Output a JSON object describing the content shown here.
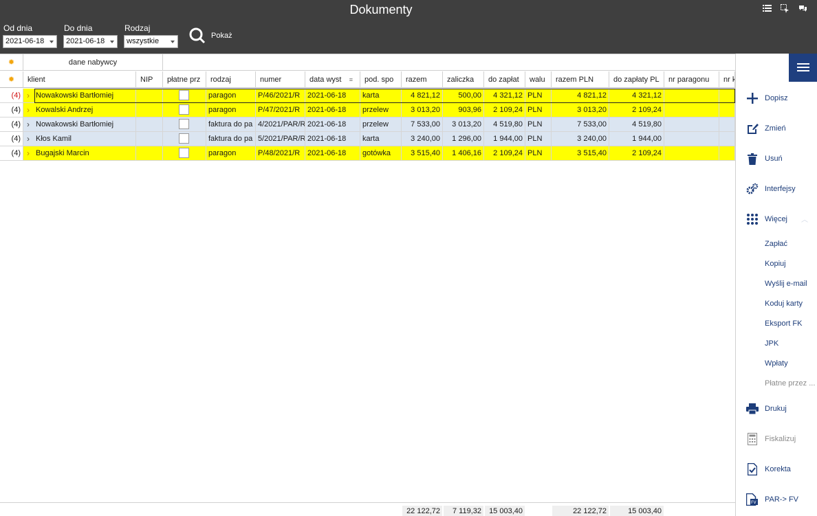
{
  "window": {
    "title": "Dokumenty"
  },
  "filters": {
    "from_label": "Od dnia",
    "from_value": "2021-06-18",
    "to_label": "Do dnia",
    "to_value": "2021-06-18",
    "type_label": "Rodzaj",
    "type_value": "wszystkie",
    "show_label": "Pokaż"
  },
  "grid": {
    "group_header": "dane nabywcy",
    "columns": [
      "klient",
      "NIP",
      "płatne prz",
      "rodzaj",
      "numer",
      "data wyst",
      "pod. spo",
      "razem",
      "zaliczka",
      "do zapłat",
      "walu",
      "razem PLN",
      "do zapłaty PL",
      "nr paragonu",
      "nr k"
    ],
    "rows": [
      {
        "count": "(4)",
        "klient": "Nowakowski Bartłomiej",
        "nip": "",
        "rodzaj": "paragon",
        "numer": "P/46/2021/R",
        "data": "2021-06-18",
        "pod": "karta",
        "razem": "4 821,12",
        "zaliczka": "500,00",
        "do_zaplaty": "4 321,12",
        "waluta": "PLN",
        "razem_pln": "4 821,12",
        "do_zaplaty_pln": "4 321,12",
        "bg": "#ffff00",
        "count_color": "#d01010"
      },
      {
        "count": "(4)",
        "klient": "Kowalski Andrzej",
        "nip": "",
        "rodzaj": "paragon",
        "numer": "P/47/2021/R",
        "data": "2021-06-18",
        "pod": "przelew",
        "razem": "3 013,20",
        "zaliczka": "903,96",
        "do_zaplaty": "2 109,24",
        "waluta": "PLN",
        "razem_pln": "3 013,20",
        "do_zaplaty_pln": "2 109,24",
        "bg": "#ffff00",
        "count_color": "#1a1a1a"
      },
      {
        "count": "(4)",
        "klient": "Nowakowski Bartłomiej",
        "nip": "",
        "rodzaj": "faktura do pa",
        "numer": "4/2021/PAR/R",
        "data": "2021-06-18",
        "pod": "przelew",
        "razem": "7 533,00",
        "zaliczka": "3 013,20",
        "do_zaplaty": "4 519,80",
        "waluta": "PLN",
        "razem_pln": "7 533,00",
        "do_zaplaty_pln": "4 519,80",
        "bg": "#dbe5f1",
        "count_color": "#1a1a1a"
      },
      {
        "count": "(4)",
        "klient": "Kłos Kamil",
        "nip": "",
        "rodzaj": "faktura do pa",
        "numer": "5/2021/PAR/R",
        "data": "2021-06-18",
        "pod": "karta",
        "razem": "3 240,00",
        "zaliczka": "1 296,00",
        "do_zaplaty": "1 944,00",
        "waluta": "PLN",
        "razem_pln": "3 240,00",
        "do_zaplaty_pln": "1 944,00",
        "bg": "#dbe5f1",
        "count_color": "#1a1a1a"
      },
      {
        "count": "(4)",
        "klient": "Bugajski Marcin",
        "nip": "",
        "rodzaj": "paragon",
        "numer": "P/48/2021/R",
        "data": "2021-06-18",
        "pod": "gotówka",
        "razem": "3 515,40",
        "zaliczka": "1 406,16",
        "do_zaplaty": "2 109,24",
        "waluta": "PLN",
        "razem_pln": "3 515,40",
        "do_zaplaty_pln": "2 109,24",
        "bg": "#ffff00",
        "count_color": "#1a1a1a"
      }
    ],
    "totals": {
      "razem": "22 122,72",
      "zaliczka": "7 119,32",
      "do_zaplaty": "15 003,40",
      "razem_pln": "22 122,72",
      "do_zaplaty_pln": "15 003,40"
    }
  },
  "sidebar": {
    "add": "Dopisz",
    "edit": "Zmień",
    "delete": "Usuń",
    "interfaces": "Interfejsy",
    "more": "Więcej",
    "sub": [
      "Zapłać",
      "Kopiuj",
      "Wyślij e-mail",
      "Koduj karty",
      "Eksport FK",
      "JPK",
      "Wpłaty",
      "Płatne przez ..."
    ],
    "print": "Drukuj",
    "fiscal": "Fiskalizuj",
    "correction": "Korekta",
    "par_fv": "PAR-> FV"
  }
}
